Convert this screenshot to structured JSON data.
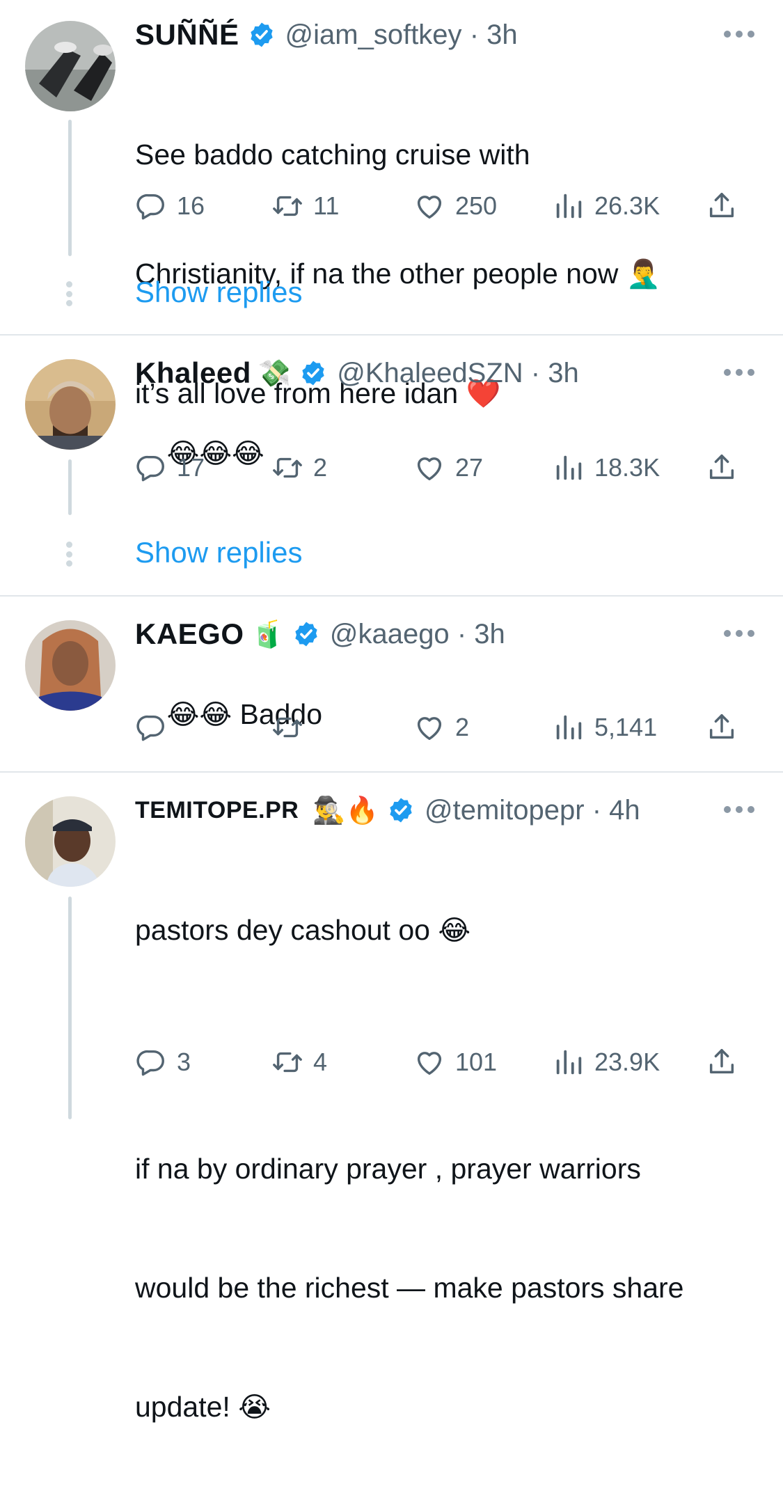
{
  "tweets": [
    {
      "name": "SUÑÑÉ",
      "handle": "@iam_softkey",
      "dot": "·",
      "time": "3h",
      "text": [
        "See baddo catching cruise with",
        "Christianity, if na the other people now",
        "it’s all love from here idan"
      ],
      "text_emojis": [
        "🤦‍♂️",
        "❤️"
      ],
      "replies": "16",
      "retweets": "11",
      "likes": "250",
      "views": "26.3K",
      "show_replies": "Show replies"
    },
    {
      "name": "Khaleed",
      "name_emoji": "💸",
      "handle": "@KhaleedSZN",
      "dot": "·",
      "time": "3h",
      "text": "😂😂😂",
      "replies": "17",
      "retweets": "2",
      "likes": "27",
      "views": "18.3K",
      "show_replies": "Show replies"
    },
    {
      "name": "KAEGO",
      "name_emoji": "🧃",
      "handle": "@kaaego",
      "dot": "·",
      "time": "3h",
      "text_emojis": "😂😂",
      "text": "Baddo",
      "replies": "",
      "retweets": "",
      "likes": "2",
      "views": "5,141"
    },
    {
      "name": "TEMITOPE.PR",
      "name_emoji": "🕵️‍♂️🔥",
      "handle": "@temitopepr",
      "dot": "·",
      "time": "4h",
      "text": [
        "pastors dey cashout oo",
        "",
        "if na by ordinary prayer , prayer warriors",
        "would be the richest — make pastors share",
        "update!"
      ],
      "text_emojis": [
        "😂",
        "😭"
      ],
      "replies": "3",
      "retweets": "4",
      "likes": "101",
      "views": "23.9K"
    }
  ],
  "colors": {
    "accent": "#1d9bf0",
    "secondary": "#536471",
    "verified": "#1d9bf0"
  },
  "icons": [
    "reply-icon",
    "retweet-icon",
    "like-icon",
    "views-icon",
    "share-icon",
    "verified-badge-icon",
    "more-icon"
  ]
}
